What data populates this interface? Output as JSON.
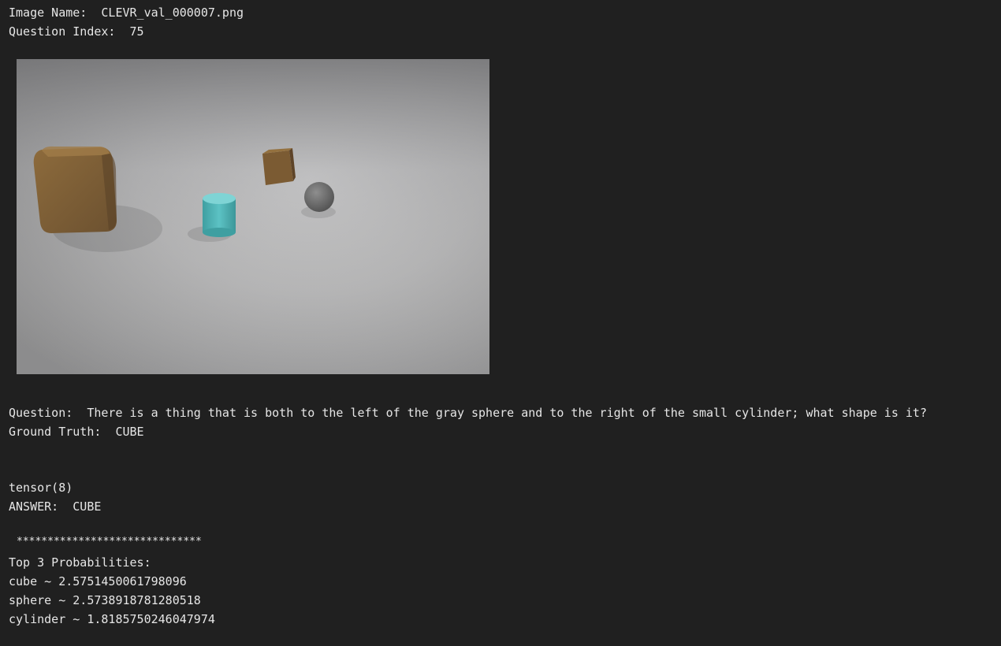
{
  "header": {
    "image_name_line": "Image Name:  CLEVR_val_000007.png",
    "question_index_line": "Question Index:  75"
  },
  "scene": {
    "objects": [
      {
        "name": "large-brown-cube",
        "color": "#7f6035"
      },
      {
        "name": "small-brown-cube",
        "color": "#7b5b33"
      },
      {
        "name": "small-gray-sphere",
        "color": "#6a6a6a"
      },
      {
        "name": "small-cyan-cylinder",
        "color": "#4fb3b5"
      }
    ]
  },
  "qa": {
    "question_line": "Question:  There is a thing that is both to the left of the gray sphere and to the right of the small cylinder; what shape is it?",
    "ground_truth_line": "Ground Truth:  CUBE"
  },
  "output": {
    "tensor_line": "tensor(8)",
    "answer_line": "ANSWER:  CUBE",
    "separator": "******************************",
    "probabilities_header": "Top 3 Probabilities:",
    "probabilities": [
      "cube ~ 2.5751450061798096",
      "sphere ~ 2.5738918781280518",
      "cylinder ~ 1.8185750246047974"
    ]
  }
}
